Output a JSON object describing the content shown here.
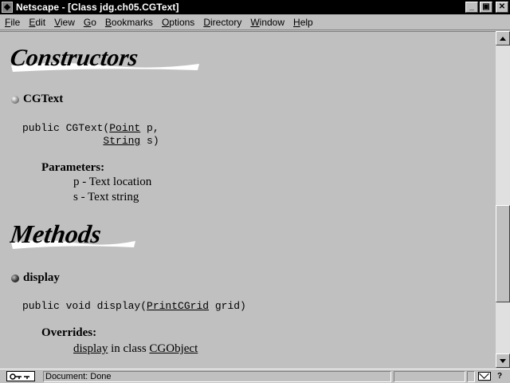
{
  "window": {
    "title": "Netscape - [Class jdg.ch05.CGText]",
    "buttons": {
      "minimize": "_",
      "maximize": "▣",
      "close": "✕"
    }
  },
  "menu": {
    "items": [
      "File",
      "Edit",
      "View",
      "Go",
      "Bookmarks",
      "Options",
      "Directory",
      "Window",
      "Help"
    ],
    "underline": [
      "F",
      "E",
      "V",
      "G",
      "B",
      "O",
      "D",
      "W",
      "H"
    ]
  },
  "content": {
    "constructors_heading": "Constructors",
    "constructor": {
      "name": "CGText",
      "sig_prefix": "public CGText(",
      "param1_type": "Point",
      "param1_rest": " p,",
      "sig_indent": "             ",
      "param2_type": "String",
      "param2_rest": " s)",
      "params_label": "Parameters:",
      "param_p": "p - Text location",
      "param_s": "s - Text string"
    },
    "methods_heading": "Methods",
    "method": {
      "name": "display",
      "sig_prefix": "public void display(",
      "param_type": "PrintCGrid",
      "param_rest": " grid)",
      "overrides_label": "Overrides:",
      "override_link": "display",
      "override_mid": " in class ",
      "override_class": "CGObject"
    }
  },
  "status": {
    "text": "Document: Done",
    "security_icon": "broken-key-icon",
    "mail_icon": "mail-icon"
  }
}
